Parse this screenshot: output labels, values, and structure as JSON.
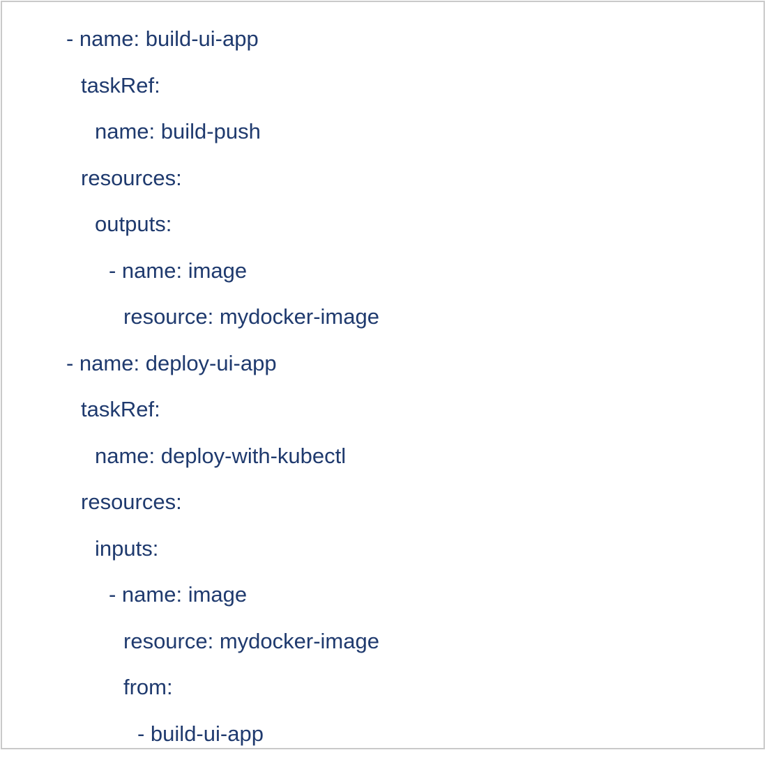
{
  "lines": [
    "- name: build-ui-app",
    "taskRef:",
    "name: build-push",
    "resources:",
    "outputs:",
    "- name: image",
    "resource: mydocker-image",
    "- name: deploy-ui-app",
    "taskRef:",
    "name: deploy-with-kubectl",
    "resources:",
    "inputs:",
    "- name: image",
    "resource: mydocker-image",
    "from:",
    "- build-ui-app"
  ]
}
